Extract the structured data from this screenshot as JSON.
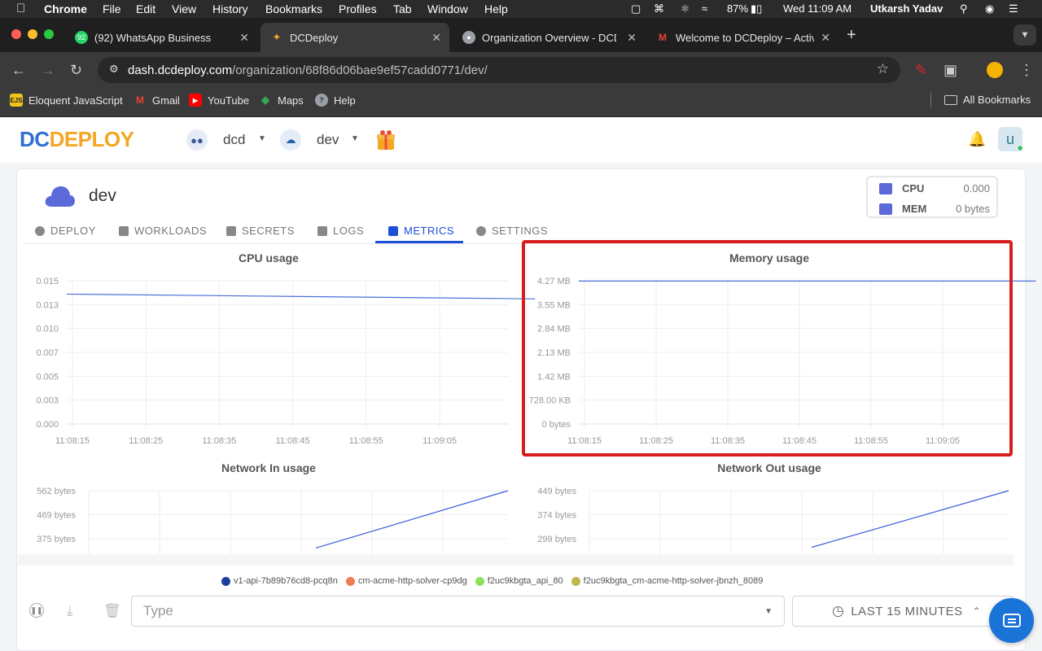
{
  "menubar": {
    "apple": "",
    "items": [
      "Chrome",
      "File",
      "Edit",
      "View",
      "History",
      "Bookmarks",
      "Profiles",
      "Tab",
      "Window",
      "Help"
    ],
    "battery": "87%",
    "datetime": "Wed 11:09 AM",
    "user": "Utkarsh Yadav"
  },
  "browser": {
    "tabs": [
      {
        "title": "(92) WhatsApp Business",
        "badge": "92",
        "icon": "whatsapp-icon",
        "color": "#25d366"
      },
      {
        "title": "DCDeploy",
        "icon": "dcdeploy-icon",
        "color": "#3a6fd8"
      },
      {
        "title": "Organization Overview - DCD",
        "icon": "globe-icon",
        "color": "#9aa0a6"
      },
      {
        "title": "Welcome to DCDeploy – Activ",
        "icon": "gmail-icon",
        "color": "#ea4335"
      }
    ],
    "new_tab": "+",
    "url_host": "dash.dcdeploy.com",
    "url_path": "/organization/68f86d06bae9ef57cadd0771/dev/",
    "bookmarks": [
      {
        "label": "Eloquent JavaScript",
        "icon": "EJS",
        "color": "#f0c419"
      },
      {
        "label": "Gmail",
        "icon": "M",
        "color": "#ea4335"
      },
      {
        "label": "YouTube",
        "icon": "▶",
        "color": "#ff0000"
      },
      {
        "label": "Maps",
        "icon": "◆",
        "color": "#34a853"
      },
      {
        "label": "Help",
        "icon": "?",
        "color": "#9aa0a6"
      }
    ],
    "all_bookmarks": "All Bookmarks"
  },
  "app": {
    "logo_dc": "DC",
    "logo_deploy": "DEPLOY",
    "org": "dcd",
    "env": "dev",
    "avatar": "u"
  },
  "environment": {
    "name": "dev",
    "cpu_label": "CPU",
    "cpu_value": "0.000",
    "mem_label": "MEM",
    "mem_value": "0 bytes"
  },
  "tabs": [
    "DEPLOY",
    "WORKLOADS",
    "SECRETS",
    "LOGS",
    "METRICS",
    "SETTINGS"
  ],
  "active_tab": "METRICS",
  "chart_data": [
    {
      "type": "line",
      "title": "CPU usage",
      "x": [
        "11:08:15",
        "11:08:25",
        "11:08:35",
        "11:08:45",
        "11:08:55",
        "11:09:05"
      ],
      "yticks": [
        "0.015",
        "0.013",
        "0.010",
        "0.007",
        "0.005",
        "0.003",
        "0.000"
      ],
      "ylim": [
        0,
        0.015
      ],
      "series": [
        {
          "x": [
            "11:08:15",
            "11:09:18"
          ],
          "values": [
            0.0136,
            0.0131
          ],
          "color": "#4a6fd8"
        }
      ]
    },
    {
      "type": "line",
      "title": "Memory usage",
      "x": [
        "11:08:15",
        "11:08:25",
        "11:08:35",
        "11:08:45",
        "11:08:55",
        "11:09:05"
      ],
      "yticks": [
        "4.27 MB",
        "3.55 MB",
        "2.84 MB",
        "2.13 MB",
        "1.42 MB",
        "728.00 KB",
        "0 bytes"
      ],
      "ylim": [
        0,
        4.27
      ],
      "series": [
        {
          "x": [
            "11:08:15",
            "11:09:18"
          ],
          "values": [
            4.26,
            4.26
          ],
          "color": "#4a6fd8"
        }
      ]
    },
    {
      "type": "line",
      "title": "Network In usage",
      "yticks": [
        "562 bytes",
        "469 bytes",
        "375 bytes"
      ],
      "ylim": [
        0,
        562
      ],
      "series": [
        {
          "values": [
            340,
            562
          ],
          "color": "#3b5bdb"
        }
      ]
    },
    {
      "type": "line",
      "title": "Network Out usage",
      "yticks": [
        "449 bytes",
        "374 bytes",
        "299 bytes"
      ],
      "ylim": [
        0,
        449
      ],
      "series": [
        {
          "values": [
            272,
            449
          ],
          "color": "#3b5bdb"
        }
      ]
    }
  ],
  "legend": [
    {
      "label": "v1-api-7b89b76cd8-pcq8n",
      "color": "#1f3fa0"
    },
    {
      "label": "cm-acme-http-solver-cp9dg",
      "color": "#f07d52"
    },
    {
      "label": "f2uc9kbgta_api_80",
      "color": "#8ee05a"
    },
    {
      "label": "f2uc9kbgta_cm-acme-http-solver-jbnzh_8089",
      "color": "#c2b64f"
    }
  ],
  "controls": {
    "type_placeholder": "Type",
    "range_label": "LAST 15 MINUTES"
  }
}
